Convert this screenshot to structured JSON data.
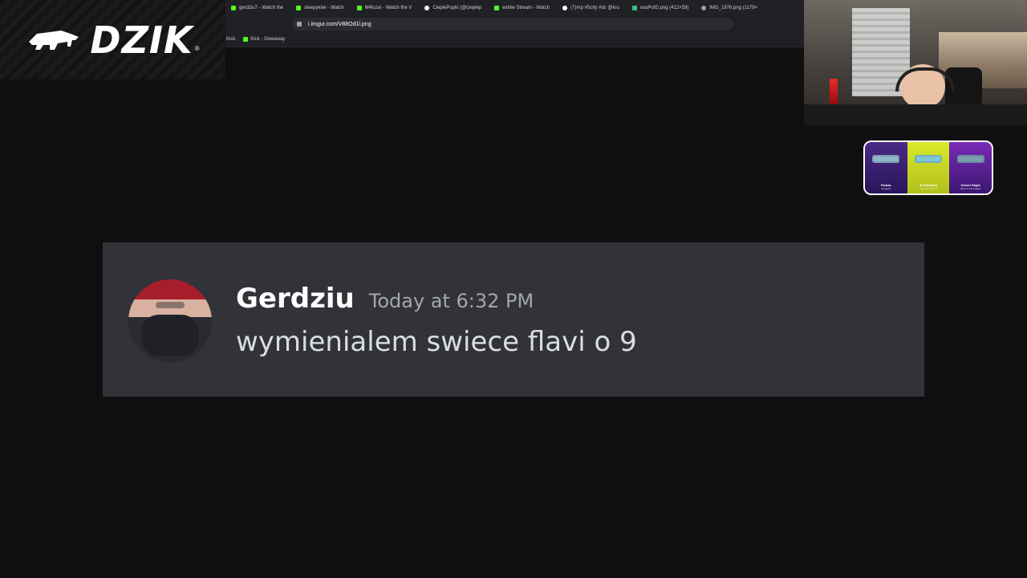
{
  "browser": {
    "tabs": [
      {
        "label": "gerdziu7 - Watch the",
        "icon": "kick-icon"
      },
      {
        "label": "sleepykiwi - Watch",
        "icon": "kick-icon"
      },
      {
        "label": "M4lszar - Watch the V",
        "icon": "kick-icon"
      },
      {
        "label": "CieplePupki (@cieplep",
        "icon": "tiktok-icon"
      },
      {
        "label": "exhiie Stream - Watch",
        "icon": "kick-icon"
      },
      {
        "label": "(7)#rp #5city #dc @kru",
        "icon": "tiktok-icon"
      },
      {
        "label": "xoaPotD.png (412×59)",
        "icon": "image-icon"
      },
      {
        "label": "IMG_1976.png (1179×",
        "icon": "globe-icon"
      }
    ],
    "address": {
      "url": "i.imgur.com/V88Od1l.png"
    },
    "bookmarks": [
      {
        "label": "Kick"
      },
      {
        "label": "Kick - Giveaway"
      }
    ]
  },
  "logo": {
    "text": "DZIK",
    "reg": "®"
  },
  "discord": {
    "username": "Gerdziu",
    "timestamp": "Today at 6:32 PM",
    "message": "wymienialem swiece flavi o 9"
  },
  "cases": [
    {
      "title": "Famas",
      "subtitle": "Sergeant"
    },
    {
      "title": "★ Karambit",
      "subtitle": "Case Hardened"
    },
    {
      "title": "Desert Eagle",
      "subtitle": "Hand of the Dragon"
    }
  ],
  "colors": {
    "discord_bg": "#313338",
    "kick_green": "#53fc18",
    "page_bg": "#0f0f10"
  }
}
